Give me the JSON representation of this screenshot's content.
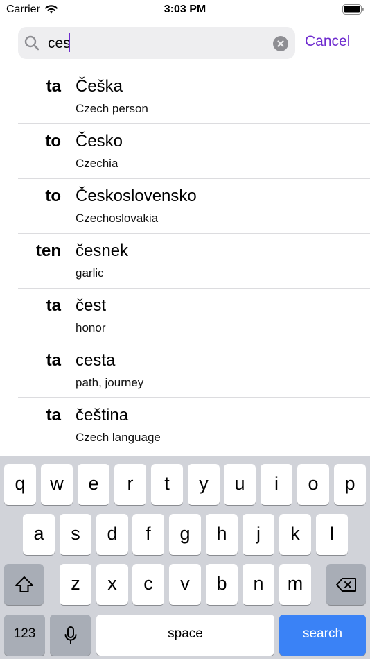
{
  "status_bar": {
    "carrier": "Carrier",
    "time": "3:03 PM"
  },
  "search": {
    "query": "ces",
    "cancel_label": "Cancel"
  },
  "results": [
    {
      "gender": "ta",
      "word": "Češka",
      "translation": "Czech person"
    },
    {
      "gender": "to",
      "word": "Česko",
      "translation": "Czechia"
    },
    {
      "gender": "to",
      "word": "Československo",
      "translation": "Czechoslovakia"
    },
    {
      "gender": "ten",
      "word": "česnek",
      "translation": "garlic"
    },
    {
      "gender": "ta",
      "word": "čest",
      "translation": "honor"
    },
    {
      "gender": "ta",
      "word": "cesta",
      "translation": "path, journey"
    },
    {
      "gender": "ta",
      "word": "čeština",
      "translation": "Czech language"
    }
  ],
  "keyboard": {
    "row1": [
      "q",
      "w",
      "e",
      "r",
      "t",
      "y",
      "u",
      "i",
      "o",
      "p"
    ],
    "row2": [
      "a",
      "s",
      "d",
      "f",
      "g",
      "h",
      "j",
      "k",
      "l"
    ],
    "row3": [
      "z",
      "x",
      "c",
      "v",
      "b",
      "n",
      "m"
    ],
    "numbers_label": "123",
    "space_label": "space",
    "search_label": "search"
  },
  "colors": {
    "accent": "#6f2ccf",
    "search_key": "#3a82f6"
  }
}
